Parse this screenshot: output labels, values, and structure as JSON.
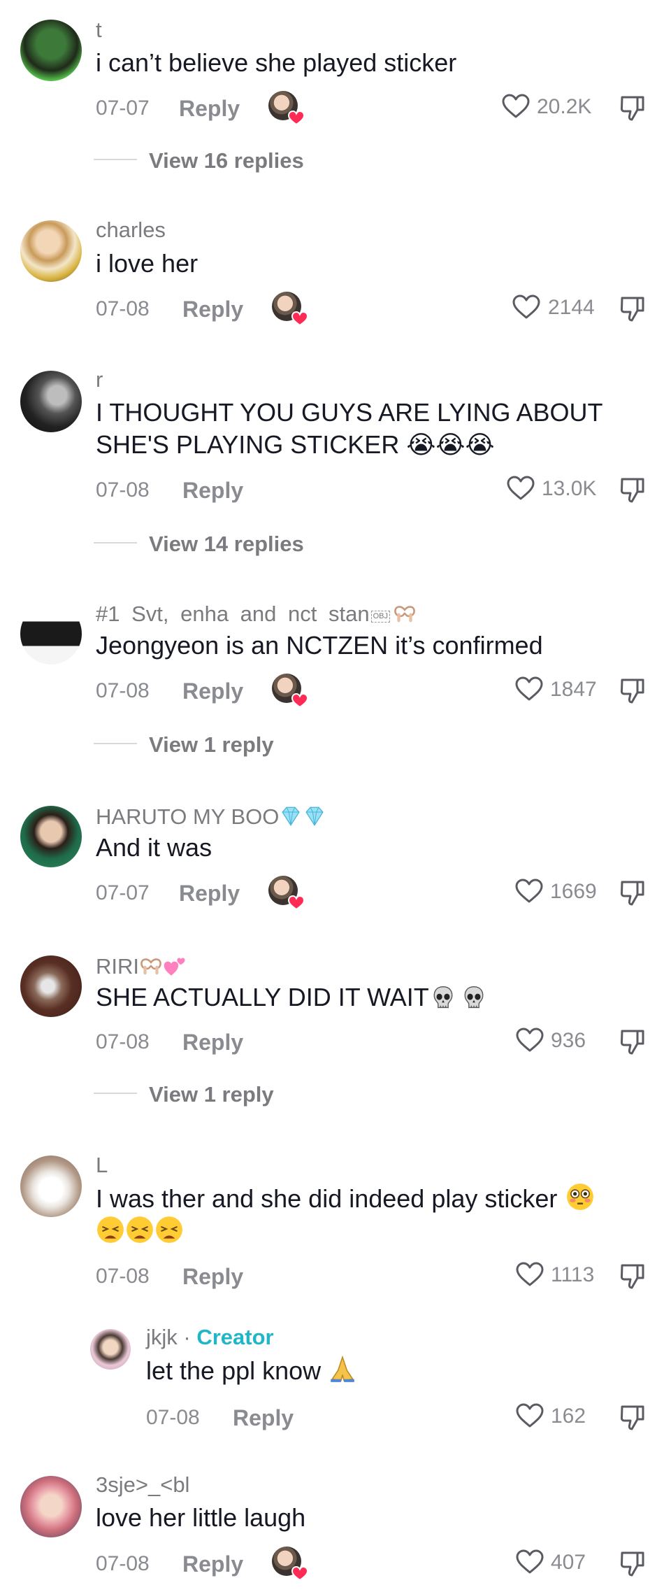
{
  "comments": [
    {
      "username": "t",
      "text": "i can’t believe she played sticker",
      "date": "07-07",
      "reply": "Reply",
      "likes": "20.2K",
      "view_replies": "View 16 replies"
    },
    {
      "username": "charles",
      "text": "i love her",
      "date": "07-08",
      "reply": "Reply",
      "likes": "2144"
    },
    {
      "username": "r",
      "text_line1": "I THOUGHT YOU GUYS ARE LYING ABOUT",
      "text_line2": "SHE'S PLAYING STICKER 😭😭😭",
      "date": "07-08",
      "reply": "Reply",
      "likes": "13.0K",
      "view_replies": "View 14 replies"
    },
    {
      "username": "#1 Svt, enha and nct stan",
      "username_suffix": "OBJ",
      "text": "Jeongyeon is an NCTZEN it’s confirmed",
      "date": "07-08",
      "reply": "Reply",
      "likes": "1847",
      "view_replies": "View 1 reply"
    },
    {
      "username": "HARUTO MY BOO",
      "text": "And it was",
      "date": "07-07",
      "reply": "Reply",
      "likes": "1669"
    },
    {
      "username": "RIRI",
      "text": "SHE ACTUALLY DID IT WAIT",
      "date": "07-08",
      "reply": "Reply",
      "likes": "936",
      "view_replies": "View 1 reply"
    },
    {
      "username": "L",
      "text_line1": "I was ther and she did indeed play sticker",
      "date": "07-08",
      "reply": "Reply",
      "likes": "1113"
    },
    {
      "username": "jkjk",
      "creator_sep": " · ",
      "creator_label": "Creator",
      "text": "let the ppl know",
      "date": "07-08",
      "reply": "Reply",
      "likes": "162"
    },
    {
      "username": "3sje>_<bl",
      "text": "love her little laugh",
      "date": "07-08",
      "reply": "Reply",
      "likes": "407"
    }
  ],
  "icons": {
    "like": "heart-outline-icon",
    "dislike": "thumbs-down-outline-icon",
    "creator_liked": "creator-liked-badge-icon"
  },
  "colors": {
    "text": "#161823",
    "muted": "#8a8b91",
    "creator": "#20b6c8",
    "heart_badge": "#fe2c55"
  }
}
